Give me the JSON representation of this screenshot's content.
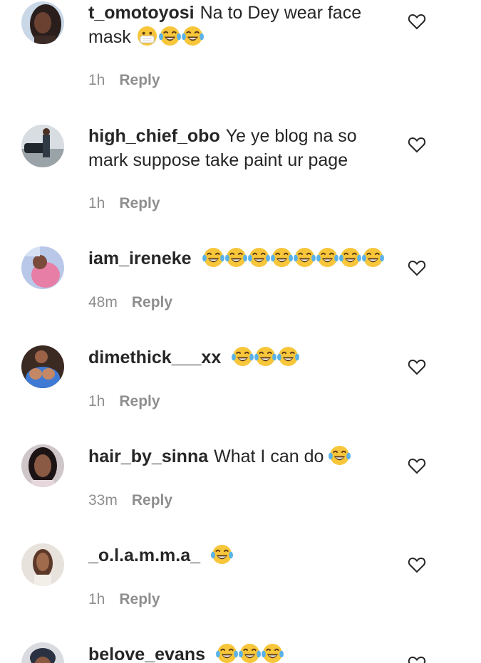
{
  "reply_label": "Reply",
  "colors": {
    "text": "#262626",
    "secondary": "#8e8e8e",
    "emoji_face": "#f7c63a",
    "tear": "#5ab2e8"
  },
  "comments": [
    {
      "username": "t_omotoyosi",
      "text": "Na to Dey wear face mask",
      "emojis": [
        "face-with-medical-mask",
        "joy",
        "joy"
      ],
      "time": "1h"
    },
    {
      "username": "high_chief_obo",
      "text": "Ye ye blog na so mark suppose take paint ur page",
      "emojis": [],
      "time": "1h"
    },
    {
      "username": "iam_ireneke",
      "text": "",
      "emojis": [
        "joy",
        "joy",
        "joy",
        "joy",
        "joy",
        "joy",
        "joy",
        "joy"
      ],
      "time": "48m"
    },
    {
      "username": "dimethick___xx",
      "text": "",
      "emojis": [
        "joy",
        "joy",
        "joy"
      ],
      "time": "1h"
    },
    {
      "username": "hair_by_sinna",
      "text": "What I can do",
      "emojis": [
        "joy"
      ],
      "time": "33m"
    },
    {
      "username": "_o.l.a.m.m.a_",
      "text": "",
      "emojis": [
        "joy"
      ],
      "time": "1h"
    },
    {
      "username": "belove_evans",
      "text": "",
      "emojis": [
        "joy",
        "joy",
        "joy"
      ],
      "time": ""
    }
  ]
}
